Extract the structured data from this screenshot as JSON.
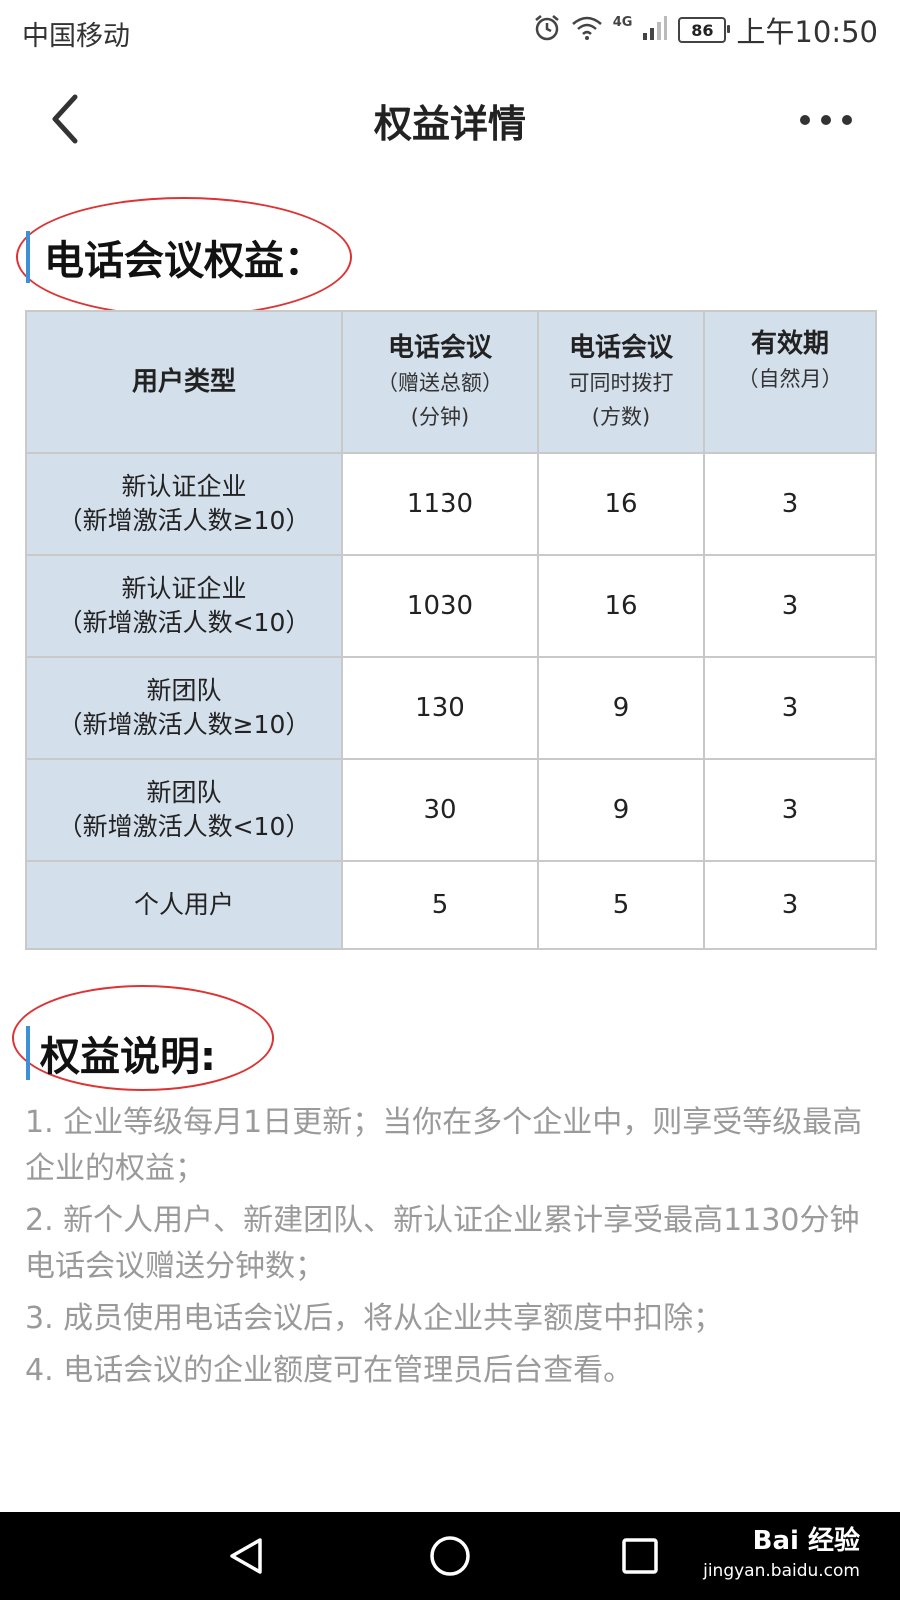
{
  "status": {
    "carrier": "中国移动",
    "network": "4G",
    "battery": "86",
    "time": "上午10:50"
  },
  "nav": {
    "title": "权益详情"
  },
  "section1": {
    "title": "电话会议权益："
  },
  "table": {
    "headers": [
      {
        "main": "用户类型",
        "sub1": "",
        "sub2": ""
      },
      {
        "main": "电话会议",
        "sub1": "（赠送总额）",
        "sub2": "(分钟)"
      },
      {
        "main": "电话会议",
        "sub1": "可同时拨打",
        "sub2": "(方数)"
      },
      {
        "main": "有效期",
        "sub1": "（自然月）",
        "sub2": ""
      }
    ],
    "rows": [
      {
        "type": "新认证企业",
        "note": "（新增激活人数≥10）",
        "minutes": "1130",
        "parties": "16",
        "months": "3"
      },
      {
        "type": "新认证企业",
        "note": "（新增激活人数<10）",
        "minutes": "1030",
        "parties": "16",
        "months": "3"
      },
      {
        "type": "新团队",
        "note": "（新增激活人数≥10）",
        "minutes": "130",
        "parties": "9",
        "months": "3"
      },
      {
        "type": "新团队",
        "note": "（新增激活人数<10）",
        "minutes": "30",
        "parties": "9",
        "months": "3"
      },
      {
        "type": "个人用户",
        "note": "",
        "minutes": "5",
        "parties": "5",
        "months": "3"
      }
    ]
  },
  "section2": {
    "title": "权益说明:"
  },
  "notes": [
    "1. 企业等级每月1日更新；当你在多个企业中，则享受等级最高企业的权益；",
    "2. 新个人用户、新建团队、新认证企业累计享受最高1130分钟电话会议赠送分钟数；",
    "3. 成员使用电话会议后，将从企业共享额度中扣除；",
    "4. 电话会议的企业额度可在管理员后台查看。"
  ],
  "watermark": {
    "brand": "Bai 经验",
    "url": "jingyan.baidu.com"
  },
  "colors": {
    "header_bg": "#d4dfec",
    "accent_bar": "#3d8fd6",
    "annotation_circle": "#d33333",
    "note_text": "#9a9a9a"
  }
}
